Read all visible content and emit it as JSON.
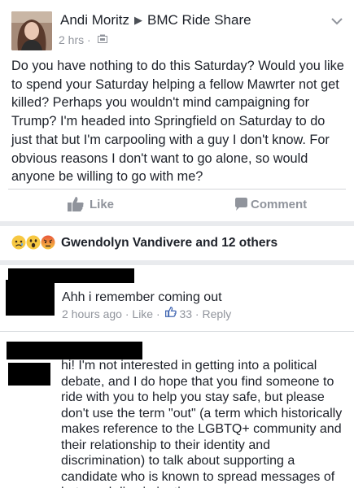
{
  "post": {
    "author": "Andi Moritz",
    "group": "BMC Ride Share",
    "time": "2 hrs",
    "body": "Do you have nothing to do this Saturday? Would you like to spend your Saturday helping a fellow Mawrter not get killed? Perhaps you wouldn't mind campaigning for Trump? I'm headed into Springfield on Saturday to do just that but I'm carpooling with a guy I don't know. For obvious reasons I don't want to go alone, so would anyone be willing to go with me?"
  },
  "actions": {
    "like_label": "Like",
    "comment_label": "Comment"
  },
  "reactions": {
    "summary": "Gwendolyn Vandivere and 12 others",
    "icons": [
      "sad-icon",
      "wow-icon",
      "angry-icon"
    ]
  },
  "comments": [
    {
      "text": "Ahh i remember coming out",
      "time": "2 hours ago",
      "like_label": "Like",
      "like_count": "33",
      "reply_label": "Reply"
    },
    {
      "text": "hi! I'm not interested in getting into a political debate, and I do hope that you find someone to ride with you to help you stay safe, but please don't use the term \"out\" (a term which historically makes reference to the LGBTQ+ community and their relationship to their identity and discrimination) to talk about supporting a candidate who is known to spread messages of hate and discrimination"
    }
  ],
  "colors": {
    "text": "#1d2129",
    "meta": "#90949c",
    "link": "#4267b2",
    "divider": "#e9ebee"
  }
}
